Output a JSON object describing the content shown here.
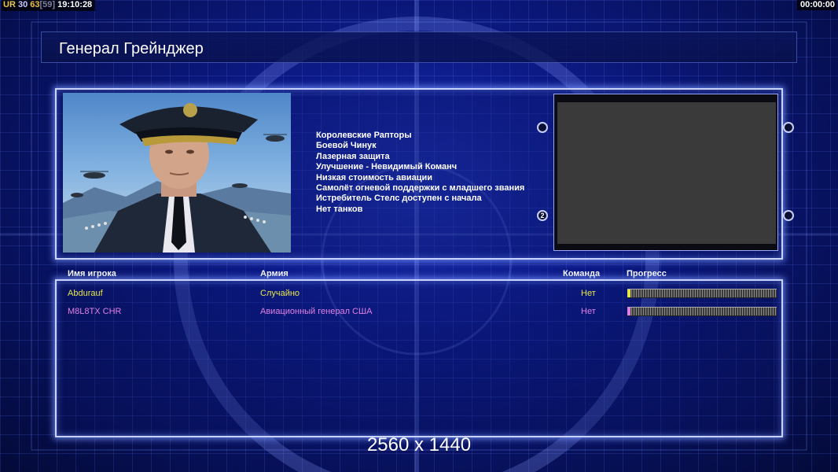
{
  "status": {
    "ur": "UR",
    "val_a": "30",
    "val_b": "63",
    "val_c": "[59]",
    "clock": "19:10:28",
    "timer": "00:00:00"
  },
  "general": {
    "title": "Генерал Грейнджер",
    "features": [
      "Королевские Рапторы",
      "Боевой Чинук",
      "Лазерная защита",
      "Улучшение - Невидимый Команч",
      "Низкая стоимость авиации",
      "Самолёт огневой поддержки с младшего звания",
      "Истребитель Стелс доступен с начала",
      "Нет танков"
    ],
    "knob_label": "2"
  },
  "table": {
    "headers": {
      "player": "Имя игрока",
      "army": "Армия",
      "team": "Команда",
      "progress": "Прогресс"
    },
    "rows": [
      {
        "player": "Abdurauf",
        "army": "Случайно",
        "team": "Нет",
        "color": "#e6e64a",
        "progress": 0.01
      },
      {
        "player": "M8L8TX CHR",
        "army": "Авиационный генерал США",
        "team": "Нет",
        "color": "#e080e0",
        "progress": 0.01
      }
    ]
  },
  "resolution": "2560 x 1440",
  "colors": {
    "accent": "#c8d4ff",
    "background": "#0c1a86"
  }
}
